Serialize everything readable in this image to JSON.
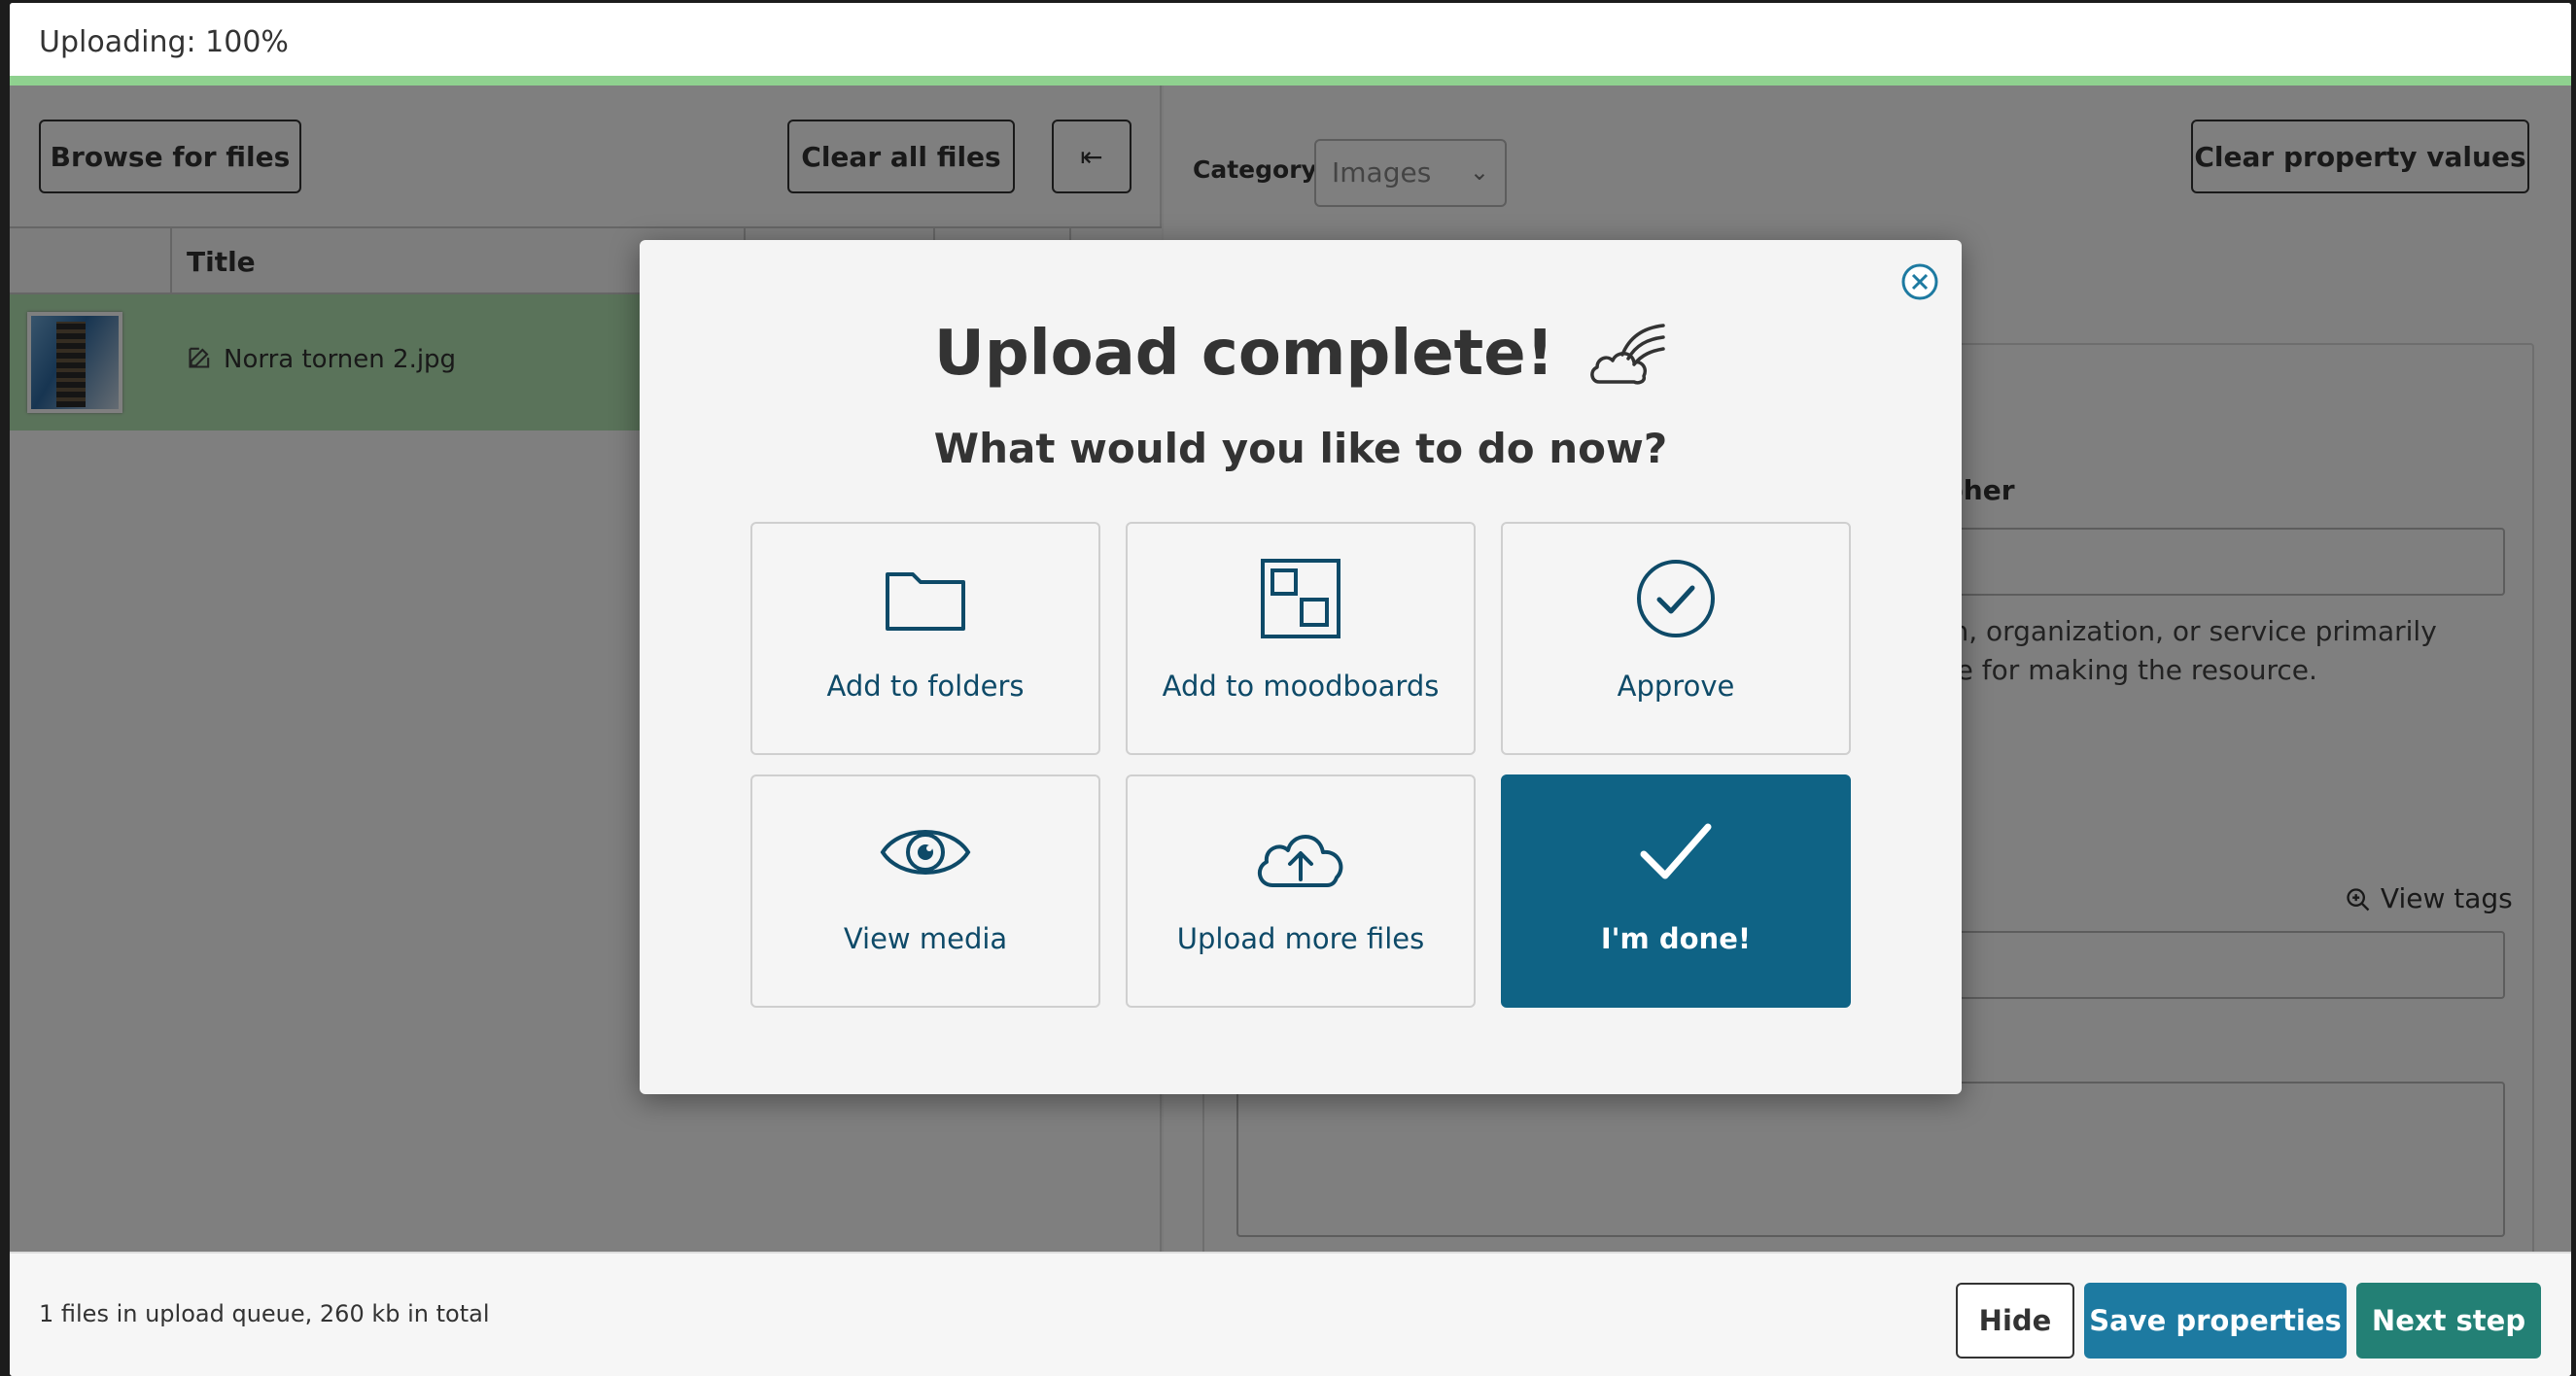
{
  "header": {
    "title": "Uploading: 100%",
    "progress_percent": 100
  },
  "left_pane": {
    "browse_label": "Browse for files",
    "clear_all_label": "Clear all files",
    "collapse_glyph": "⇤",
    "column_title": "Title",
    "file_name": "Norra tornen 2.jpg"
  },
  "right_pane": {
    "category_label": "Category",
    "category_value": "Images",
    "clear_props_label": "Clear property values",
    "photographer_label": "grapher",
    "photographer_desc": "erson, organization, or service primarily nsible for making the resource.",
    "view_tags_label": "View tags"
  },
  "footer": {
    "queue_text": "1 files in upload queue, 260 kb in total",
    "hide_label": "Hide",
    "save_label": "Save properties",
    "next_label": "Next step"
  },
  "modal": {
    "title": "Upload complete!",
    "subtitle": "What would you like to do now?",
    "tiles": [
      {
        "label": "Add to folders",
        "icon": "folder-icon"
      },
      {
        "label": "Add to moodboards",
        "icon": "moodboard-icon"
      },
      {
        "label": "Approve",
        "icon": "check-circle-icon"
      },
      {
        "label": "View media",
        "icon": "eye-icon"
      },
      {
        "label": "Upload more files",
        "icon": "cloud-upload-icon"
      },
      {
        "label": "I'm done!",
        "icon": "checkmark-icon"
      }
    ]
  },
  "colors": {
    "accent": "#0f6385",
    "save": "#1d7aa1",
    "next": "#238075",
    "progress": "#8fd18f",
    "row_selected": "#b5e6b5"
  }
}
